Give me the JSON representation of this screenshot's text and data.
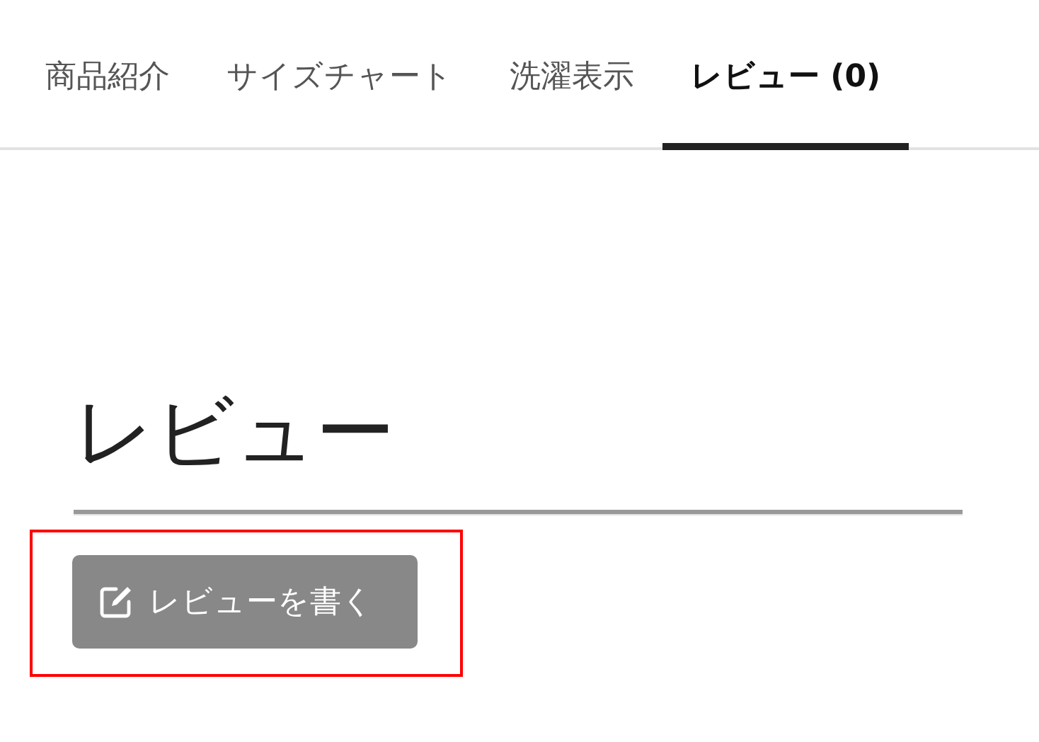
{
  "tabs": [
    {
      "label": "商品紹介",
      "selected": false
    },
    {
      "label": "サイズチャート",
      "selected": false
    },
    {
      "label": "洗濯表示",
      "selected": false
    },
    {
      "label": "レビュー (0)",
      "selected": true
    }
  ],
  "section": {
    "heading": "レビュー",
    "button": {
      "label": "レビューを書く",
      "highlighted": true
    }
  }
}
